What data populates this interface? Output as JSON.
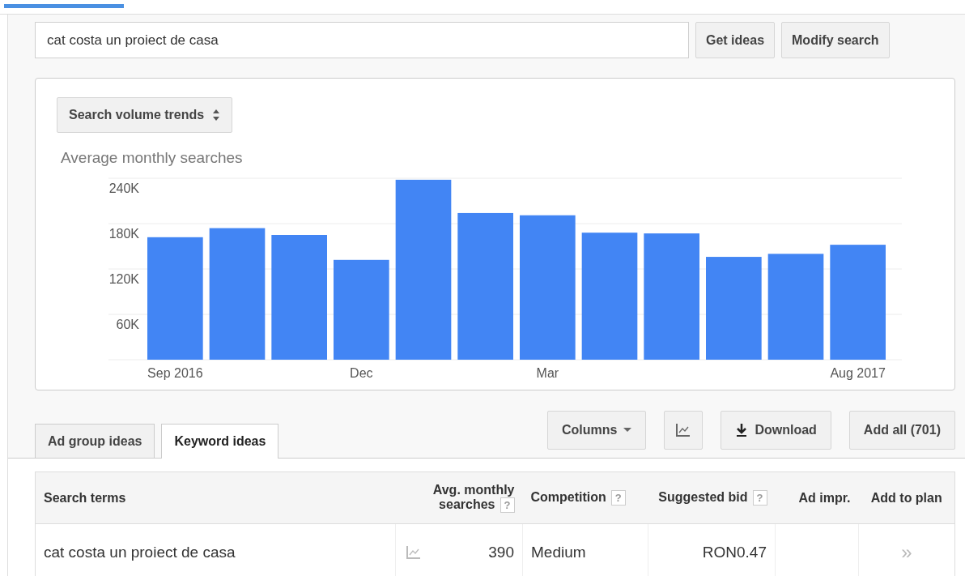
{
  "search": {
    "value": "cat costa un proiect de casa"
  },
  "search_buttons": [
    "Get ideas",
    "Modify search"
  ],
  "chart_panel": {
    "selector": "Search volume trends",
    "chart_data": {
      "type": "bar",
      "title": "Average monthly searches",
      "values": [
        162000,
        174000,
        165000,
        132000,
        238000,
        194000,
        191000,
        168000,
        167000,
        136000,
        140000,
        152000
      ],
      "categories": [
        "Sep 2016",
        null,
        null,
        "Dec",
        null,
        null,
        "Mar",
        null,
        null,
        null,
        null,
        "Aug 2017"
      ],
      "grid": true,
      "ylim": [
        0,
        240000
      ],
      "yticks": [
        {
          "value": 60000,
          "label": "60K"
        },
        {
          "value": 120000,
          "label": "120K"
        },
        {
          "value": 180000,
          "label": "180K"
        },
        {
          "value": 240000,
          "label": "240K"
        }
      ]
    }
  },
  "tabs": [
    {
      "label": "Ad group ideas",
      "selected": false
    },
    {
      "label": "Keyword ideas",
      "selected": true
    }
  ],
  "toolbar": {
    "columns": "Columns",
    "download": "Download",
    "add_all": "Add all (701)"
  },
  "table": {
    "columns": [
      {
        "label": "Search terms",
        "help": false
      },
      {
        "label": "Avg. monthly searches",
        "help": true
      },
      {
        "label": "Competition",
        "help": true
      },
      {
        "label": "Suggested bid",
        "help": true
      },
      {
        "label": "Ad impr.",
        "help": false
      },
      {
        "label": "Add to plan",
        "help": false
      }
    ],
    "help_mark": "?",
    "rows": [
      {
        "term": "cat costa un proiect de casa",
        "searches": "390",
        "competition": "Medium",
        "bid": "RON0.47",
        "add": "»"
      }
    ]
  }
}
